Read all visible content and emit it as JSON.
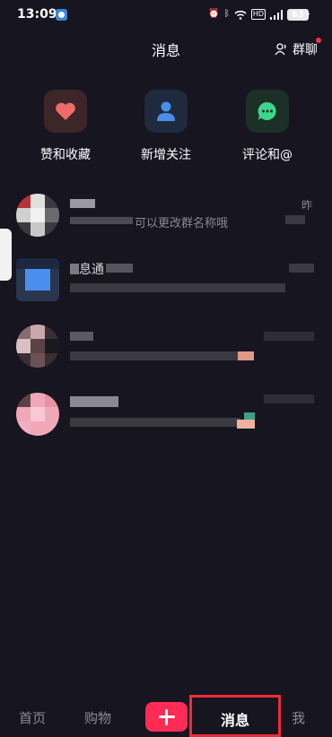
{
  "status_bar": {
    "time": "13:09",
    "icons": [
      "alarm-icon",
      "bluetooth-icon",
      "wifi-icon",
      "hd-icon",
      "signal-icon"
    ],
    "hd": "HD",
    "battery": "63"
  },
  "header": {
    "title": "消息",
    "group_chat_label": "群聊"
  },
  "categories": [
    {
      "label": "赞和收藏",
      "icon": "heart-icon",
      "color": "#f06a6a",
      "bg": "#3d2628"
    },
    {
      "label": "新增关注",
      "icon": "person-icon",
      "color": "#4a8fe6",
      "bg": "#1f2a3f"
    },
    {
      "label": "评论和@",
      "icon": "comment-icon",
      "color": "#3dd68c",
      "bg": "#1c3027"
    }
  ],
  "messages": [
    {
      "name": "",
      "preview": "可以更改群名称哦",
      "time": "昨"
    },
    {
      "name": "息通",
      "preview": "",
      "time": ""
    },
    {
      "name": "",
      "preview": "",
      "time": ""
    },
    {
      "name": "",
      "preview": "",
      "time": ""
    }
  ],
  "bottom_nav": {
    "home": "首页",
    "shop": "购物",
    "messages": "消息",
    "me": "我"
  },
  "colors": {
    "background": "#161520",
    "accent": "#fe2c55",
    "highlight_box": "#ef2b3a"
  }
}
